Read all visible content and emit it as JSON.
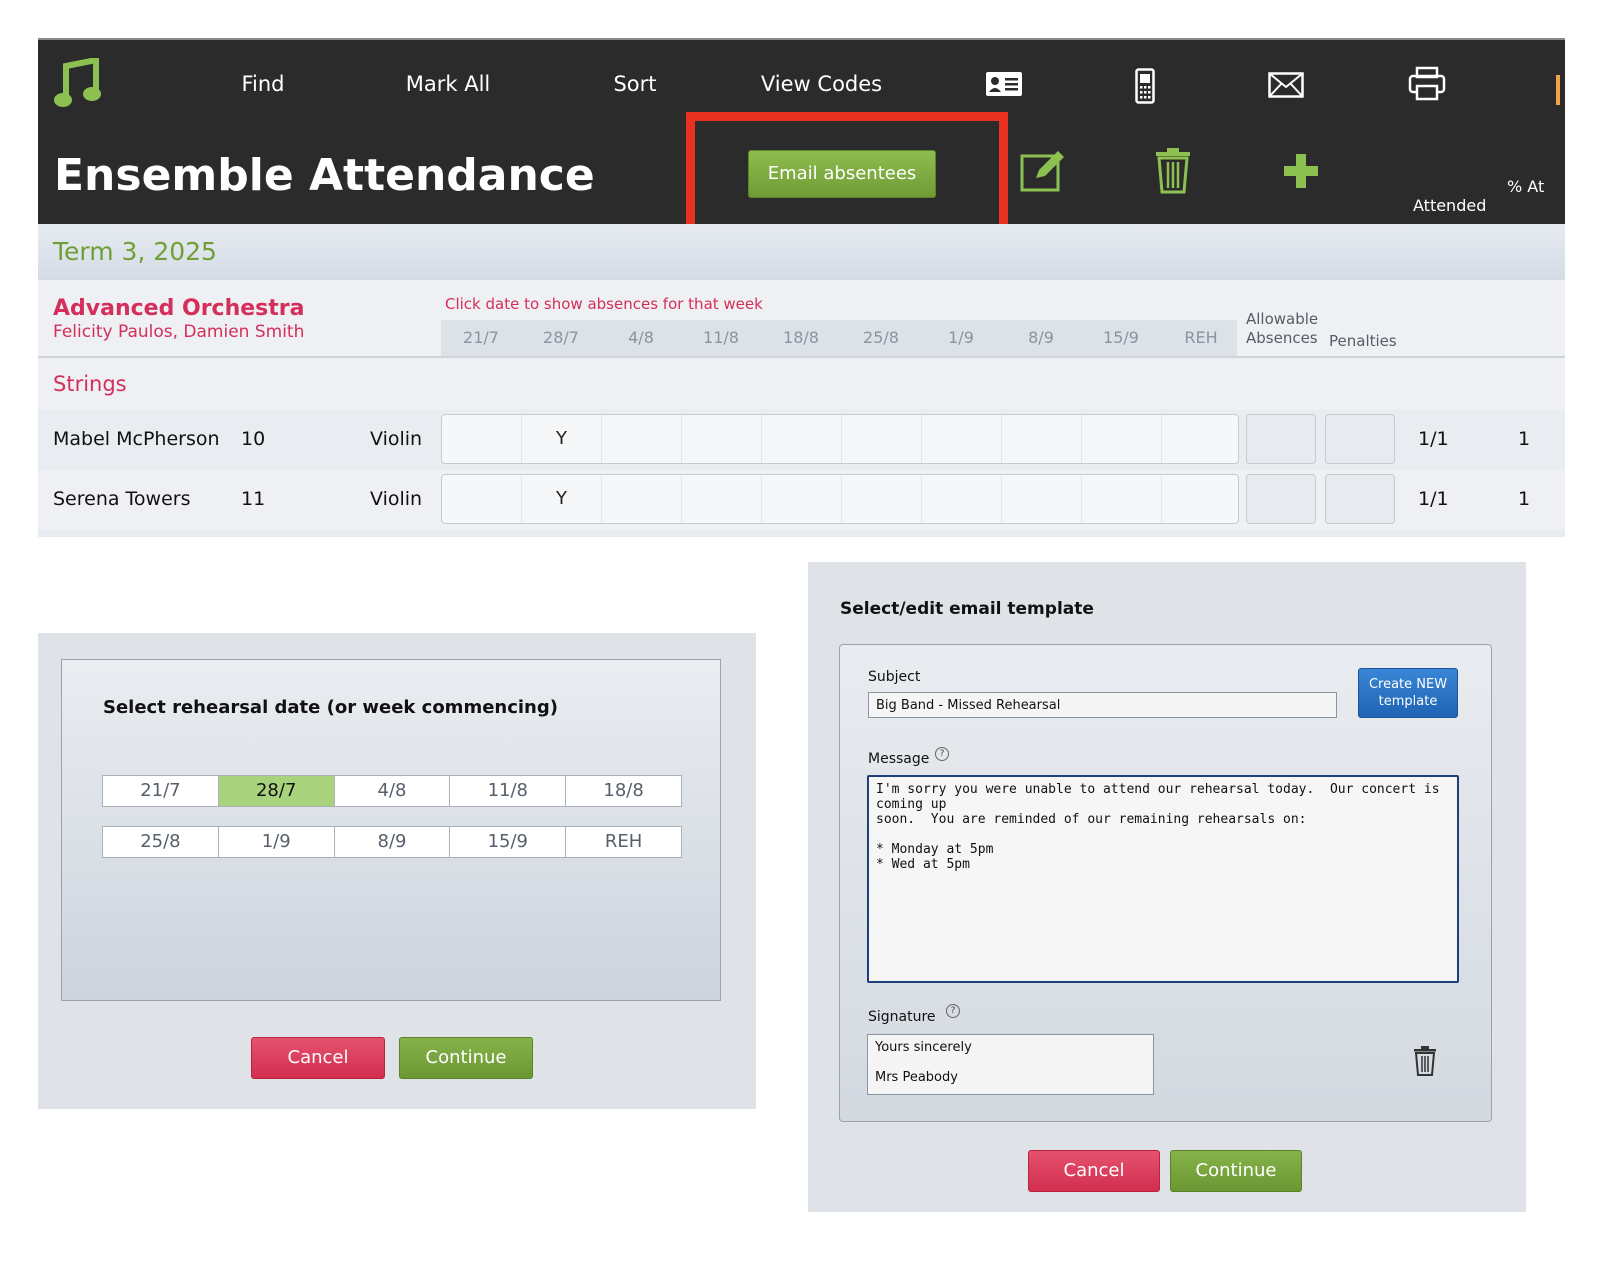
{
  "toolbar": {
    "find": "Find",
    "mark_all": "Mark All",
    "sort": "Sort",
    "view_codes": "View Codes",
    "icons": [
      "music-note-icon",
      "id-card-icon",
      "mobile-phone-icon",
      "envelope-icon",
      "printer-icon"
    ]
  },
  "header": {
    "title": "Ensemble Attendance",
    "email_absentees": "Email absentees",
    "col_attended": "Attended",
    "col_pct": "% At",
    "icons": [
      "edit-icon",
      "trash-icon",
      "plus-icon"
    ]
  },
  "term": {
    "label": "Term 3, 2025"
  },
  "group": {
    "name": "Advanced Orchestra",
    "staff": "Felicity Paulos, Damien Smith",
    "hint": "Click date to show absences for that week",
    "dates": [
      "21/7",
      "28/7",
      "4/8",
      "11/8",
      "18/8",
      "25/8",
      "1/9",
      "8/9",
      "15/9",
      "REH"
    ],
    "allowable_line1": "Allowable",
    "allowable_line2": "Absences",
    "penalties": "Penalties"
  },
  "section": {
    "label": "Strings"
  },
  "students": [
    {
      "name": "Mabel McPherson",
      "year": "10",
      "instrument": "Violin",
      "marks": [
        "",
        "Y",
        "",
        "",
        "",
        "",
        "",
        "",
        "",
        ""
      ],
      "attended": "1/1",
      "pct": "1"
    },
    {
      "name": "Serena Towers",
      "year": "11",
      "instrument": "Violin",
      "marks": [
        "",
        "Y",
        "",
        "",
        "",
        "",
        "",
        "",
        "",
        ""
      ],
      "attended": "1/1",
      "pct": "1"
    }
  ],
  "rehearsal_dialog": {
    "title": "Select rehearsal date (or week commencing)",
    "dates_row1": [
      "21/7",
      "28/7",
      "4/8",
      "11/8",
      "18/8"
    ],
    "dates_row2": [
      "25/8",
      "1/9",
      "8/9",
      "15/9",
      "REH"
    ],
    "selected": "28/7",
    "cancel": "Cancel",
    "continue": "Continue"
  },
  "email_dialog": {
    "title": "Select/edit email template",
    "subject_label": "Subject",
    "subject_value": "Big Band - Missed Rehearsal",
    "create_new": "Create NEW template",
    "message_label": "Message",
    "message_value": "I'm sorry you were unable to attend our rehearsal today.  Our concert is coming up\nsoon.  You are reminded of our remaining rehearsals on:\n\n* Monday at 5pm\n* Wed at 5pm",
    "signature_label": "Signature",
    "signature_value": "Yours sincerely\n\nMrs Peabody",
    "cancel": "Cancel",
    "continue": "Continue"
  },
  "colors": {
    "accent_green": "#7aa83c",
    "accent_pink": "#d42f5a",
    "highlight_red": "#e8321f",
    "toolbar_bg": "#2b2b2b",
    "button_blue": "#2a6fc2"
  }
}
